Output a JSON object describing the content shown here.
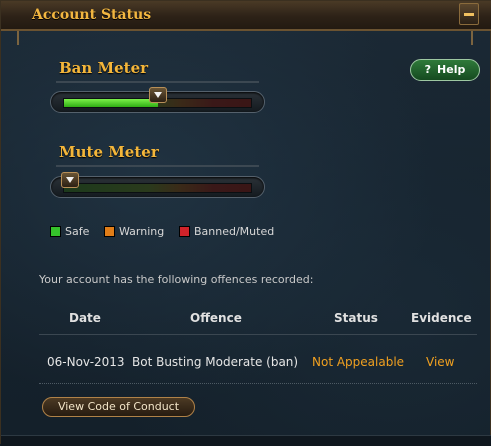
{
  "window": {
    "title": "Account Status"
  },
  "help": {
    "q": "?",
    "label": "Help"
  },
  "ban_meter": {
    "label": "Ban Meter",
    "level": 0.5
  },
  "mute_meter": {
    "label": "Mute Meter",
    "level": 0.0
  },
  "legend": [
    {
      "label": "Safe",
      "color": "#35c22b"
    },
    {
      "label": "Warning",
      "color": "#e07d18"
    },
    {
      "label": "Banned/Muted",
      "color": "#d0232a"
    }
  ],
  "intro_text": "Your account has the following offences recorded:",
  "table": {
    "headers": [
      "Date",
      "Offence",
      "Status",
      "Evidence"
    ],
    "rows": [
      {
        "date": "06-Nov-2013",
        "offence": "Bot Busting Moderate (ban)",
        "status": "Not Appealable",
        "evidence": "View"
      }
    ]
  },
  "buttons": {
    "code_of_conduct": "View Code of Conduct"
  },
  "colors": {
    "title": "#f2b640",
    "status_text": "#f0a020",
    "link_text": "#f0a020"
  }
}
